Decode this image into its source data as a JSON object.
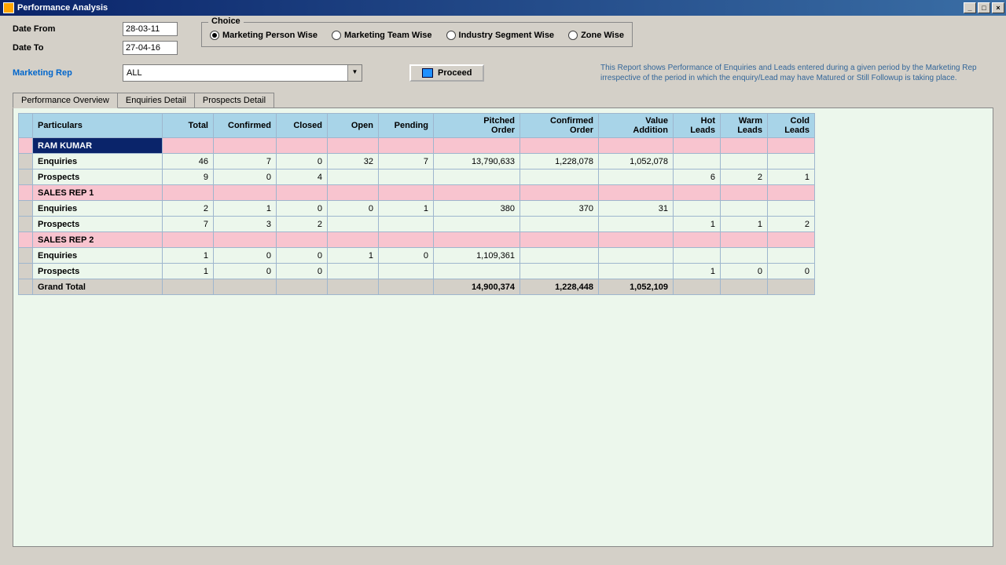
{
  "window": {
    "title": "Performance Analysis"
  },
  "filters": {
    "date_from_label": "Date From",
    "date_to_label": "Date To",
    "date_from": "28-03-11",
    "date_to": "27-04-16",
    "rep_label": "Marketing Rep",
    "rep_value": "ALL"
  },
  "choice": {
    "legend": "Choice",
    "options": [
      {
        "label": "Marketing Person Wise",
        "checked": true
      },
      {
        "label": "Marketing Team Wise",
        "checked": false
      },
      {
        "label": "Industry Segment Wise",
        "checked": false
      },
      {
        "label": "Zone Wise",
        "checked": false
      }
    ]
  },
  "proceed_label": "Proceed",
  "hint": "This Report shows Performance of Enquiries and Leads entered during a given period by the Marketing Rep irrespective of the period in which the enquiry/Lead may have Matured or Still Followup is taking place.",
  "tabs": {
    "overview": "Performance Overview",
    "enquiries": "Enquiries Detail",
    "prospects": "Prospects Detail"
  },
  "headers": {
    "particulars": "Particulars",
    "total": "Total",
    "confirmed": "Confirmed",
    "closed": "Closed",
    "open": "Open",
    "pending": "Pending",
    "pitched_order": "Pitched Order",
    "confirmed_order": "Confirmed Order",
    "value_addition": "Value Addition",
    "hot_leads": "Hot Leads",
    "warm_leads": "Warm Leads",
    "cold_leads": "Cold Leads"
  },
  "rows": [
    {
      "type": "rep",
      "selected": true,
      "particulars": "RAM KUMAR"
    },
    {
      "type": "data",
      "particulars": "Enquiries",
      "total": "46",
      "confirmed": "7",
      "closed": "0",
      "open": "32",
      "pending": "7",
      "pitched_order": "13,790,633",
      "confirmed_order": "1,228,078",
      "value_addition": "1,052,078",
      "hot": "",
      "warm": "",
      "cold": ""
    },
    {
      "type": "data",
      "particulars": "Prospects",
      "total": "9",
      "confirmed": "0",
      "closed": "4",
      "open": "",
      "pending": "",
      "pitched_order": "",
      "confirmed_order": "",
      "value_addition": "",
      "hot": "6",
      "warm": "2",
      "cold": "1"
    },
    {
      "type": "rep",
      "particulars": "SALES REP 1"
    },
    {
      "type": "data",
      "particulars": "Enquiries",
      "total": "2",
      "confirmed": "1",
      "closed": "0",
      "open": "0",
      "pending": "1",
      "pitched_order": "380",
      "confirmed_order": "370",
      "value_addition": "31",
      "hot": "",
      "warm": "",
      "cold": ""
    },
    {
      "type": "data",
      "particulars": "Prospects",
      "total": "7",
      "confirmed": "3",
      "closed": "2",
      "open": "",
      "pending": "",
      "pitched_order": "",
      "confirmed_order": "",
      "value_addition": "",
      "hot": "1",
      "warm": "1",
      "cold": "2"
    },
    {
      "type": "rep",
      "particulars": "SALES REP 2"
    },
    {
      "type": "data",
      "particulars": "Enquiries",
      "total": "1",
      "confirmed": "0",
      "closed": "0",
      "open": "1",
      "pending": "0",
      "pitched_order": "1,109,361",
      "confirmed_order": "",
      "value_addition": "",
      "hot": "",
      "warm": "",
      "cold": ""
    },
    {
      "type": "data",
      "particulars": "Prospects",
      "total": "1",
      "confirmed": "0",
      "closed": "0",
      "open": "",
      "pending": "",
      "pitched_order": "",
      "confirmed_order": "",
      "value_addition": "",
      "hot": "1",
      "warm": "0",
      "cold": "0"
    },
    {
      "type": "total",
      "particulars": "Grand Total",
      "total": "",
      "confirmed": "",
      "closed": "",
      "open": "",
      "pending": "",
      "pitched_order": "14,900,374",
      "confirmed_order": "1,228,448",
      "value_addition": "1,052,109",
      "hot": "",
      "warm": "",
      "cold": ""
    }
  ],
  "col_widths": {
    "particulars": 165,
    "total": 65,
    "confirmed": 80,
    "closed": 65,
    "open": 65,
    "pending": 70,
    "pitched_order": 110,
    "confirmed_order": 100,
    "value_addition": 95,
    "hot": 60,
    "warm": 60,
    "cold": 60
  }
}
